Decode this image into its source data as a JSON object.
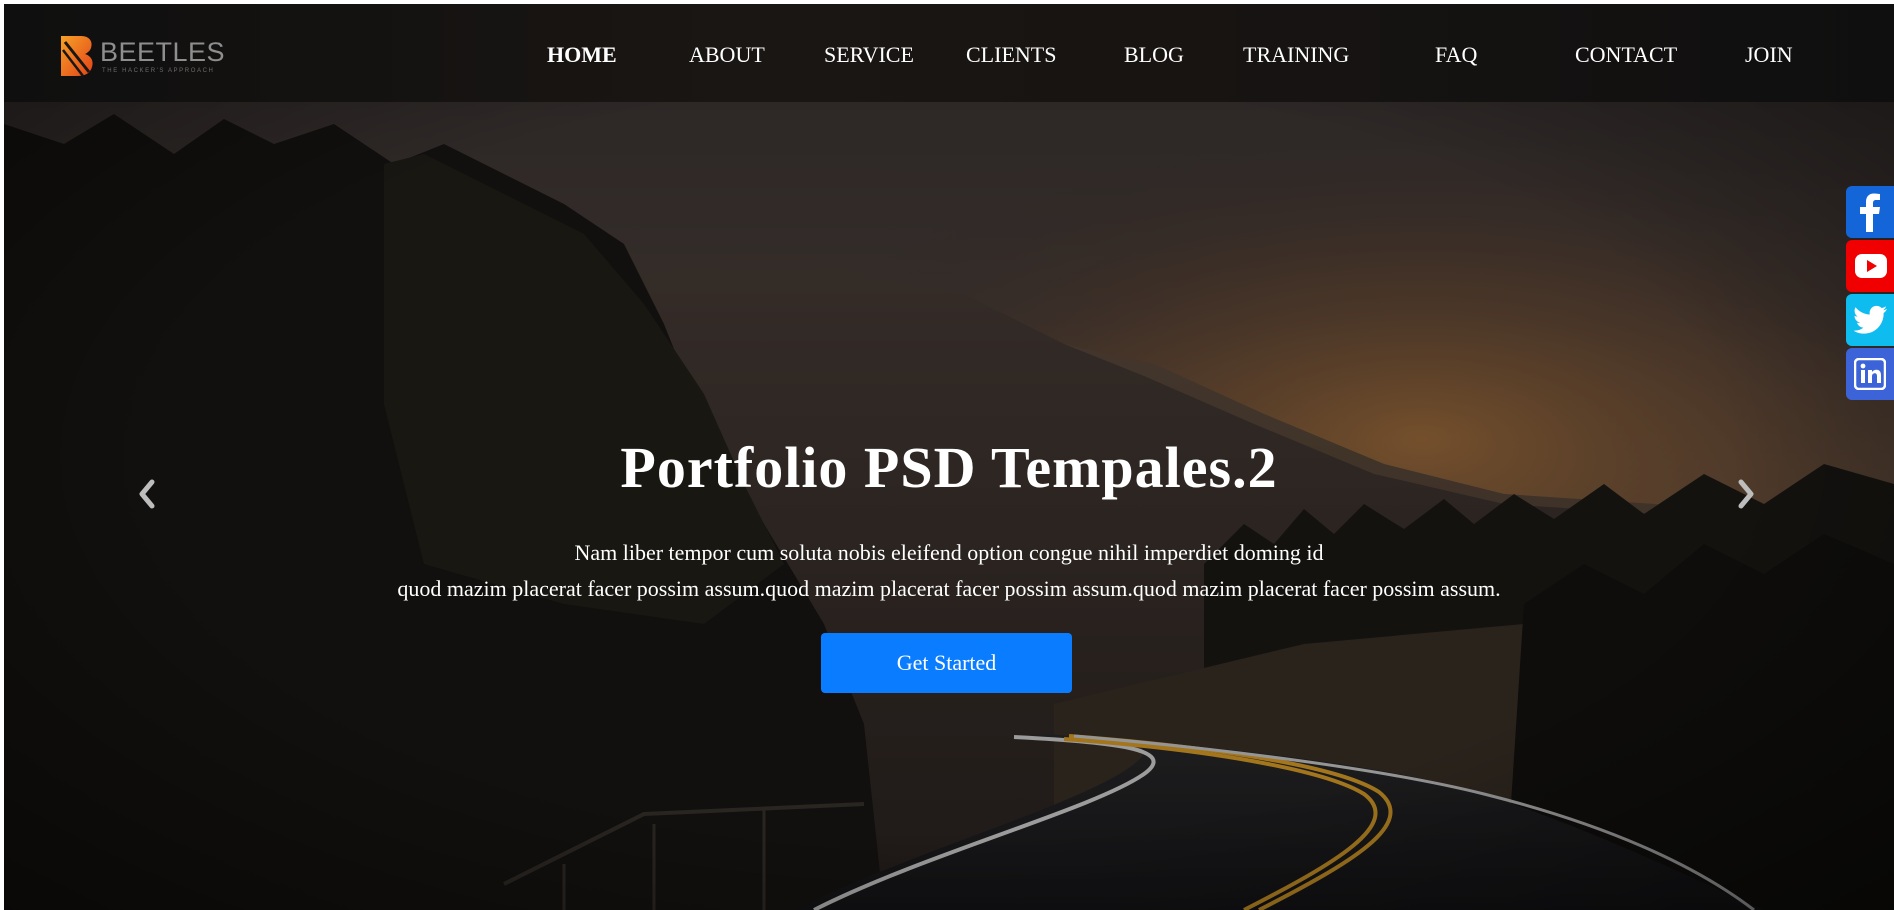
{
  "brand": {
    "name": "BEETLES",
    "tagline": "THE HACKER'S APPROACH"
  },
  "nav": {
    "items": [
      {
        "label": "HOME",
        "active": true
      },
      {
        "label": "ABOUT",
        "active": false
      },
      {
        "label": "SERVICE",
        "active": false
      },
      {
        "label": "CLIENTS",
        "active": false
      },
      {
        "label": "BLOG",
        "active": false
      },
      {
        "label": "TRAINING",
        "active": false
      },
      {
        "label": "FAQ",
        "active": false
      },
      {
        "label": "CONTACT",
        "active": false
      },
      {
        "label": "JOIN",
        "active": false
      }
    ]
  },
  "hero": {
    "title": "Portfolio PSD Tempales.2",
    "text_line1": "Nam liber tempor cum soluta nobis eleifend option congue nihil imperdiet doming id",
    "text_line2": "quod mazim placerat facer possim assum.quod mazim placerat facer possim assum.quod mazim placerat facer possim assum.",
    "cta_label": "Get Started",
    "prev_icon": "chevron-left-icon",
    "next_icon": "chevron-right-icon"
  },
  "social": [
    {
      "name": "facebook",
      "icon": "facebook-icon",
      "color": "#1466d8"
    },
    {
      "name": "youtube",
      "icon": "youtube-icon",
      "color": "#f00000"
    },
    {
      "name": "twitter",
      "icon": "twitter-icon",
      "color": "#0fbcf0"
    },
    {
      "name": "linkedin",
      "icon": "linkedin-icon",
      "color": "#3c64d8"
    }
  ],
  "colors": {
    "accent": "#0a7cff",
    "header_bg": "#141210",
    "logo_orange": "#f26a1b"
  }
}
